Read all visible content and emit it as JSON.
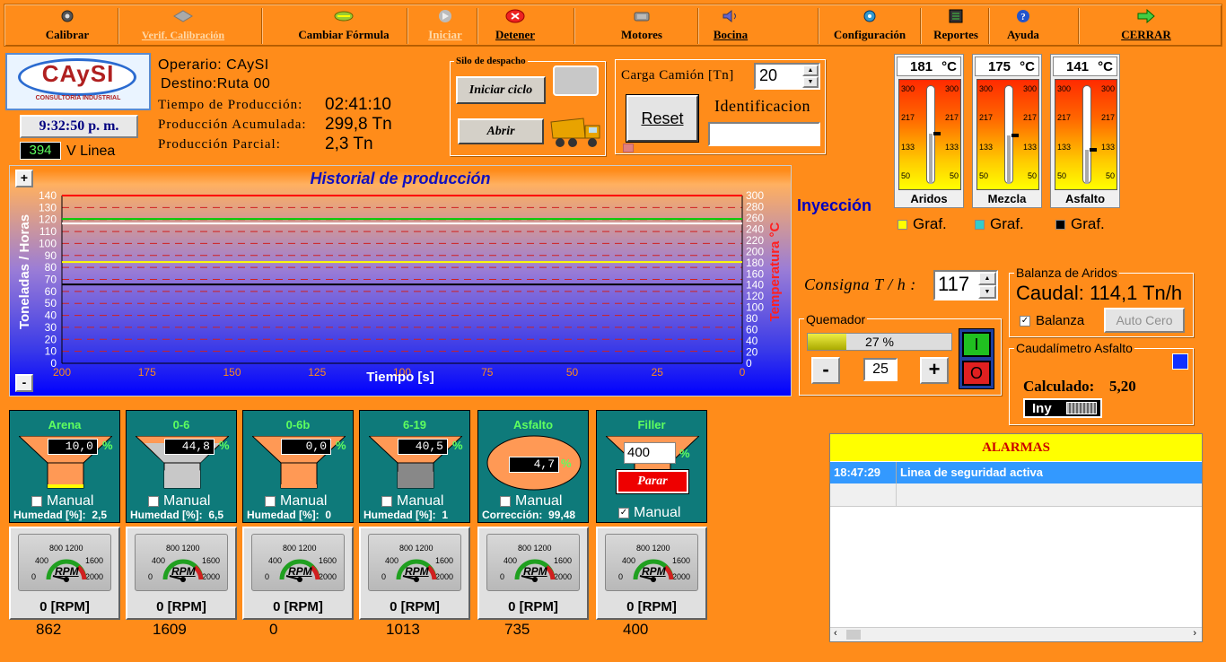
{
  "toolbar": {
    "calibrar": "Calibrar",
    "verif": "Verif. Calibración",
    "cambiar": "Cambiar Fórmula",
    "iniciar": "Iniciar",
    "detener": "Detener",
    "motores": "Motores",
    "bocina": "Bocina",
    "config": "Configuración",
    "reportes": "Reportes",
    "ayuda": "Ayuda",
    "cerrar": "CERRAR"
  },
  "logo": {
    "name": "CAySI",
    "sub": "CONSULTORÍA INDUSTRIAL"
  },
  "clock": "9:32:50 p. m.",
  "vlinea": {
    "value": "394",
    "label": "V Linea"
  },
  "info": {
    "operario": "Operario: CAySI",
    "destino": "Destino:Ruta 00",
    "tiempo_label": "Tiempo de Producción:",
    "tiempo_value": "02:41:10",
    "acum_label": "Producción Acumulada:",
    "acum_value": "299,8 Tn",
    "parcial_label": "Producción Parcial:",
    "parcial_value": "2,3 Tn"
  },
  "silo": {
    "title": "Silo de despacho",
    "iniciar": "Iniciar ciclo",
    "abrir": "Abrir"
  },
  "carga": {
    "label": "Carga Camión [Tn]",
    "value": "20",
    "reset": "Reset",
    "ident": "Identificacion"
  },
  "thermos": [
    {
      "value": "181",
      "unit": "°C",
      "label": "Aridos",
      "level": 0.52,
      "graf_color": "#ffff00"
    },
    {
      "value": "175",
      "unit": "°C",
      "label": "Mezcla",
      "level": 0.5,
      "graf_color": "#33cccc"
    },
    {
      "value": "141",
      "unit": "°C",
      "label": "Asfalto",
      "level": 0.36,
      "graf_color": "#000000"
    }
  ],
  "thermo_ticks": [
    "300",
    "217",
    "133",
    "50"
  ],
  "graf_label": "Graf.",
  "inyeccion": "Inyección",
  "consigna": {
    "label": "Consigna T / h :",
    "value": "117"
  },
  "quemador": {
    "title": "Quemador",
    "percent": "27 %",
    "level": 0.27,
    "value": "25",
    "minus": "-",
    "plus": "+",
    "on": "I",
    "off": "O"
  },
  "balanza": {
    "title": "Balanza de Aridos",
    "caudal": "Caudal: 114,1 Tn/h",
    "check": "Balanza",
    "autocero": "Auto Cero"
  },
  "caudalimetro": {
    "title": "Caudalímetro Asfalto",
    "calc_label": "Calculado:",
    "calc_value": "5,20",
    "iny": "Iny"
  },
  "chart_data": {
    "type": "line",
    "title": "Historial de producción",
    "xlabel": "Tiempo [s]",
    "ylabel": "Toneladas / Horas",
    "ylabel2": "Temperatura °C",
    "x_ticks": [
      "200",
      "175",
      "150",
      "125",
      "100",
      "75",
      "50",
      "25",
      "0"
    ],
    "y_ticks": [
      "140",
      "130",
      "120",
      "110",
      "100",
      "90",
      "80",
      "70",
      "60",
      "50",
      "40",
      "30",
      "20",
      "10",
      "0"
    ],
    "y2_ticks": [
      "300",
      "280",
      "260",
      "240",
      "220",
      "200",
      "180",
      "160",
      "140",
      "120",
      "100",
      "80",
      "60",
      "40",
      "20",
      "0"
    ],
    "ylim": [
      0,
      140
    ],
    "y2lim": [
      0,
      300
    ],
    "series": [
      {
        "color": "#ff0000",
        "y2": 300
      },
      {
        "color": "#00cc00",
        "y2": 258
      },
      {
        "color": "#ffffff",
        "y2": 250
      },
      {
        "color": "#ffff00",
        "y2": 181
      },
      {
        "color": "#000000",
        "y2": 141
      }
    ],
    "plus": "+",
    "minus": "-"
  },
  "hoppers": [
    {
      "name": "Arena",
      "value": "10,0",
      "sub_label": "Humedad [%]:",
      "sub_value": "2,5",
      "manual": "Manual",
      "fill": 0.08,
      "rpm": "0 [RPM]",
      "below": "862"
    },
    {
      "name": "0-6",
      "value": "44,8",
      "sub_label": "Humedad [%]:",
      "sub_value": "6,5",
      "manual": "Manual",
      "fill": 0.7,
      "rpm": "0 [RPM]",
      "below": "1609"
    },
    {
      "name": "0-6b",
      "value": "0,0",
      "sub_label": "Humedad [%]:",
      "sub_value": "0",
      "manual": "Manual",
      "fill": 0,
      "rpm": "0 [RPM]",
      "below": "0"
    },
    {
      "name": "6-19",
      "value": "40,5",
      "sub_label": "Humedad [%]:",
      "sub_value": "1",
      "manual": "Manual",
      "fill": 0.65,
      "rpm": "0 [RPM]",
      "below": "1013"
    },
    {
      "name": "Asfalto",
      "value": "4,7",
      "sub_label": "Corrección:",
      "sub_value": "99,48",
      "manual": "Manual",
      "fill": 0,
      "rpm": "0 [RPM]",
      "below": "735"
    },
    {
      "name": "Filler",
      "value": "400",
      "sub_label": "",
      "sub_value": "",
      "manual": "Manual",
      "parar": "Parar",
      "fill": 0,
      "rpm": "0 [RPM]",
      "below": "400"
    }
  ],
  "gauge_labels": {
    "l1": "800 1200",
    "l2": "400",
    "l3": "1600",
    "l4": "0",
    "l5": "2000",
    "rpm": "RPM"
  },
  "pct": "%",
  "alarms": {
    "title": "ALARMAS",
    "rows": [
      {
        "time": "18:47:29",
        "msg": "Linea de seguridad activa"
      }
    ]
  }
}
